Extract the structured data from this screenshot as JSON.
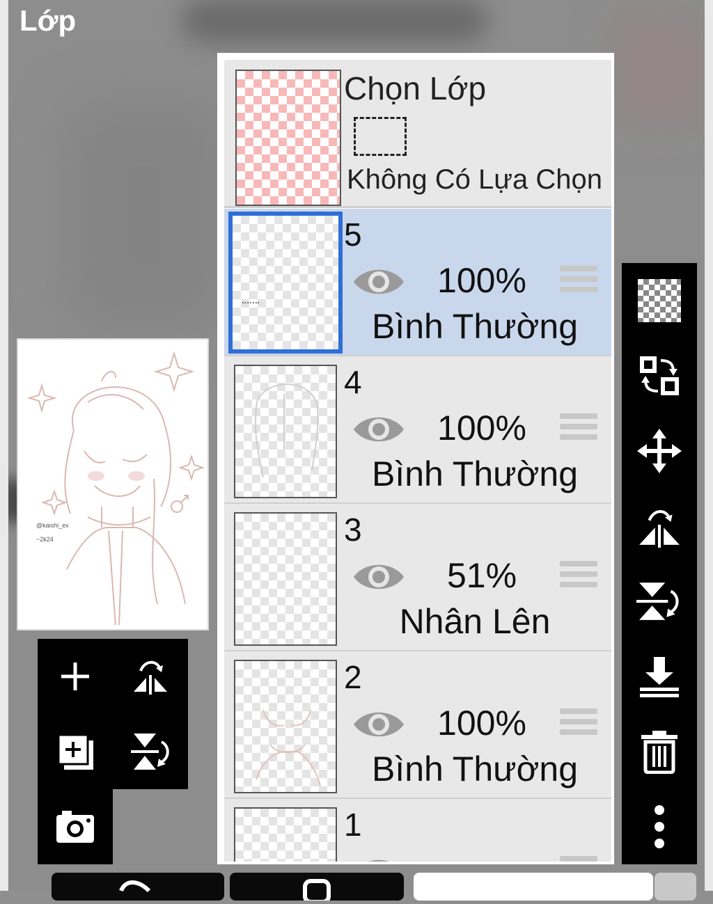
{
  "panel_title": "Lớp",
  "selection_layer": {
    "title": "Chọn Lớp",
    "status": "Không Có Lựa Chọn"
  },
  "layers": [
    {
      "number": "5",
      "opacity": "100%",
      "blend_mode": "Bình Thường",
      "visible": true,
      "selected": true
    },
    {
      "number": "4",
      "opacity": "100%",
      "blend_mode": "Bình Thường",
      "visible": true,
      "selected": false
    },
    {
      "number": "3",
      "opacity": "51%",
      "blend_mode": "Nhân Lên",
      "visible": true,
      "selected": false
    },
    {
      "number": "2",
      "opacity": "100%",
      "blend_mode": "Bình Thường",
      "visible": true,
      "selected": false
    },
    {
      "number": "1",
      "opacity": "",
      "blend_mode": "",
      "visible": true,
      "selected": false
    }
  ],
  "left_toolbar": {
    "icons": [
      "add-layer-icon",
      "flip-horizontal-icon",
      "add-layer-copy-icon",
      "flip-vertical-icon",
      "camera-icon"
    ]
  },
  "right_toolbar": {
    "icons": [
      "transparency-icon",
      "swap-layer-icon",
      "move-icon",
      "flip-horizontal-icon",
      "flip-vertical-icon",
      "merge-down-icon",
      "trash-icon",
      "more-options-icon"
    ]
  },
  "colors": {
    "active_layer_bg": "#c9d7ec",
    "active_layer_border": "#2f6fd6",
    "selection_checker": "#f7b8b8"
  }
}
